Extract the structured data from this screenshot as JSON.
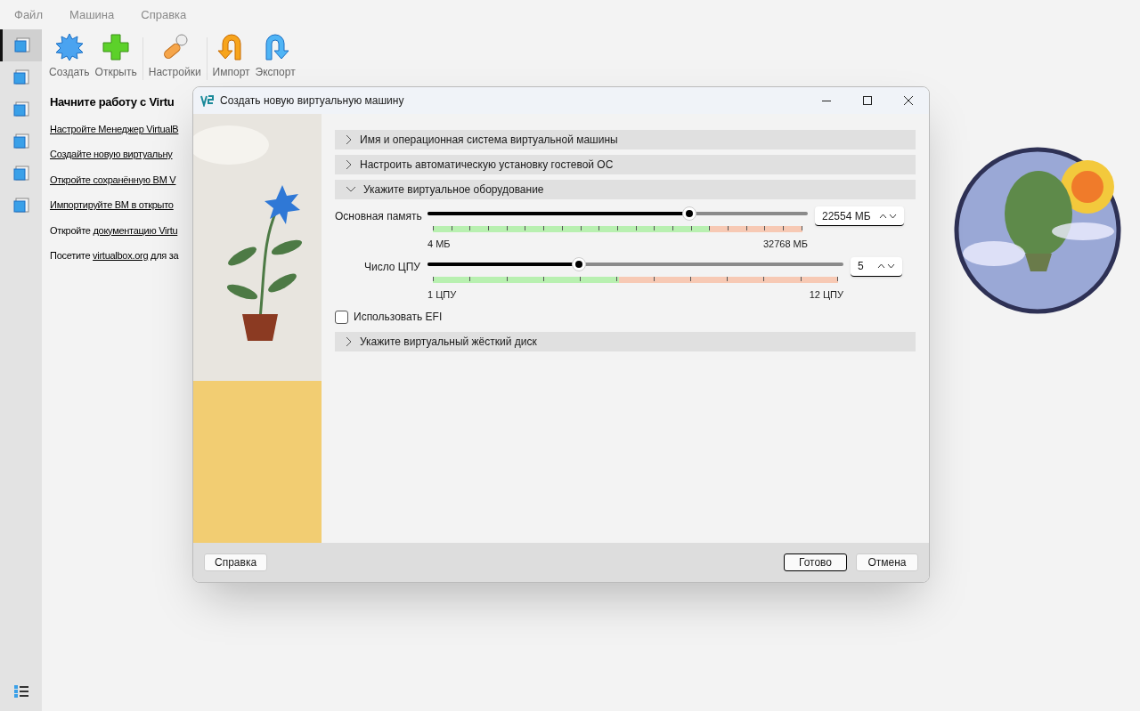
{
  "menu": [
    "Файл",
    "Машина",
    "Справка"
  ],
  "sidebar": {
    "tools": [
      {
        "selected": true
      },
      {
        "selected": false
      },
      {
        "selected": false
      },
      {
        "selected": false
      },
      {
        "selected": false
      },
      {
        "selected": false
      }
    ]
  },
  "toolbar": [
    {
      "kind": "new",
      "label": "Создать"
    },
    {
      "kind": "add",
      "label": "Открыть"
    },
    {
      "kind": "settings",
      "label": "Настройки"
    },
    {
      "kind": "import",
      "label": "Импорт"
    },
    {
      "kind": "export",
      "label": "Экспорт"
    }
  ],
  "welcome": {
    "heading": "Начните работу с Virtu",
    "lines": [
      {
        "kind": "link",
        "text": "Настройте Менеджер VirtualB"
      },
      {
        "kind": "link",
        "text": "Создайте новую виртуальну"
      },
      {
        "kind": "link",
        "text": "Откройте сохранённую ВМ V"
      },
      {
        "kind": "link",
        "text": "Импортируйте ВМ в открыто"
      },
      {
        "kind": "mixed",
        "before": "Откройте ",
        "link": "документацию Virtu"
      },
      {
        "kind": "mixed",
        "before": "Посетите ",
        "link": "virtualbox.org",
        "after": " для за"
      }
    ]
  },
  "dialog": {
    "title": "Создать новую виртуальную машину",
    "sections": [
      {
        "title": "Имя и операционная система виртуальной машины",
        "expanded": false
      },
      {
        "title": "Настроить автоматическую установку гостевой ОС",
        "expanded": false
      },
      {
        "title": "Укажите виртуальное оборудование",
        "expanded": true,
        "sliders": [
          {
            "label": "Основная память",
            "level": 0.688,
            "min": "4 МБ",
            "max": "32768 МБ",
            "value": "22554 МБ"
          },
          {
            "label": "Число ЦПУ",
            "level": 0.364,
            "min": "1 ЦПУ",
            "max": "12 ЦПУ",
            "value": "5"
          }
        ],
        "efi": {
          "label": "Использовать EFI",
          "checked": false
        }
      },
      {
        "title": "Укажите виртуальный жёсткий диск",
        "expanded": false
      }
    ],
    "buttons": [
      {
        "label": "Справка",
        "default": false
      },
      {
        "label": "Готово",
        "default": true
      },
      {
        "label": "Отмена",
        "default": false
      }
    ]
  }
}
